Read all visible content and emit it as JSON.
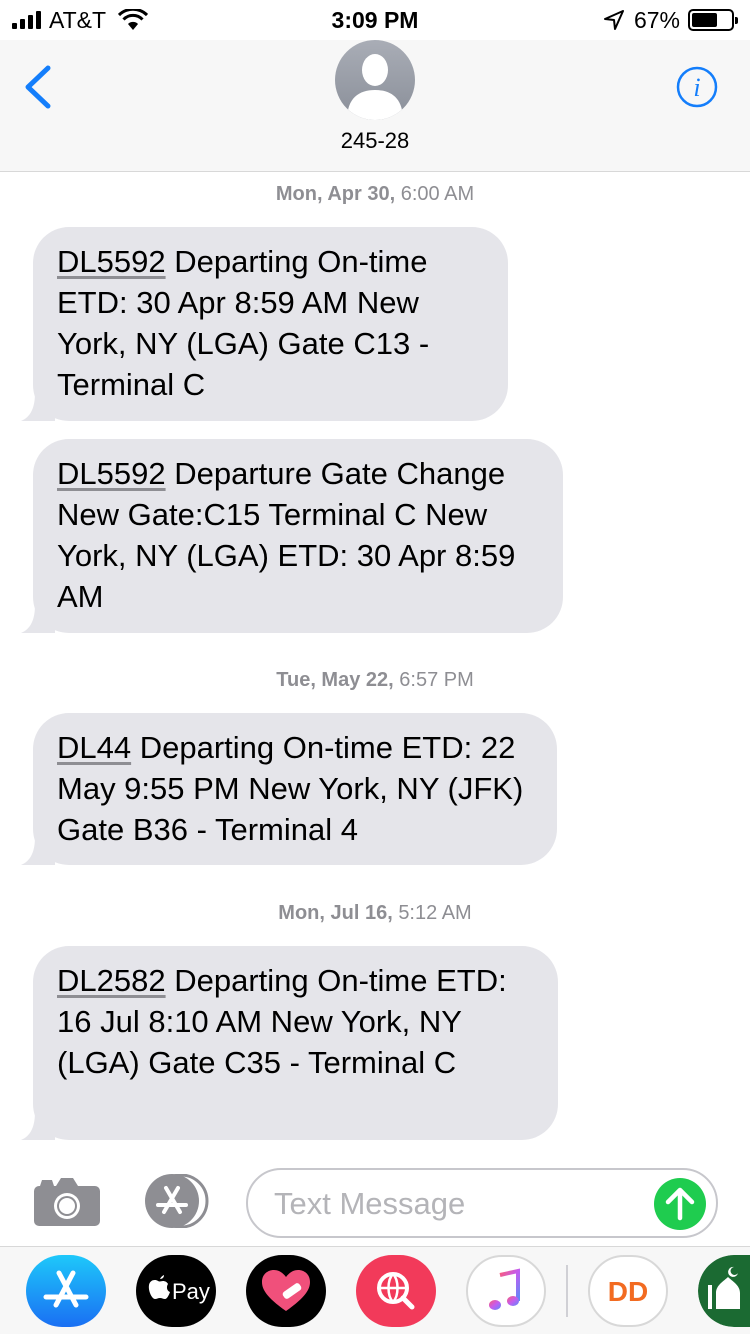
{
  "status": {
    "carrier": "AT&T",
    "time": "3:09 PM",
    "battery_percent": "67%",
    "battery_level": 0.67
  },
  "nav": {
    "contact": "245-28"
  },
  "thread": {
    "groups": [
      {
        "day": "Mon, Apr 30,",
        "time": "6:00 AM",
        "messages": [
          {
            "flight": "DL5592",
            "text": " Departing On-time ETD: 30 Apr 8:59 AM New York, NY (LGA) Gate C13 - Terminal C"
          },
          {
            "flight": "DL5592",
            "text": " Departure Gate Change New Gate:C15 Terminal C New York, NY (LGA) ETD: 30 Apr 8:59 AM"
          }
        ]
      },
      {
        "day": "Tue, May 22,",
        "time": "6:57 PM",
        "messages": [
          {
            "flight": "DL44",
            "text": " Departing On-time ETD: 22 May 9:55 PM New York, NY (JFK) Gate B36 - Terminal 4"
          }
        ]
      },
      {
        "day": "Mon, Jul 16,",
        "time": "5:12 AM",
        "messages": [
          {
            "flight": "DL2582",
            "text": " Departing On-time ETD: 16 Jul 8:10 AM New York, NY (LGA) Gate C35 - Terminal C"
          }
        ]
      }
    ]
  },
  "compose": {
    "placeholder": "Text Message"
  },
  "drawer": {
    "apple_pay_label": "Pay",
    "dunkin_label": "DD"
  },
  "colors": {
    "accent": "#147efb",
    "bubble": "#e5e5ea",
    "send": "#1fcc4f",
    "timestamp": "#8e8e93"
  }
}
